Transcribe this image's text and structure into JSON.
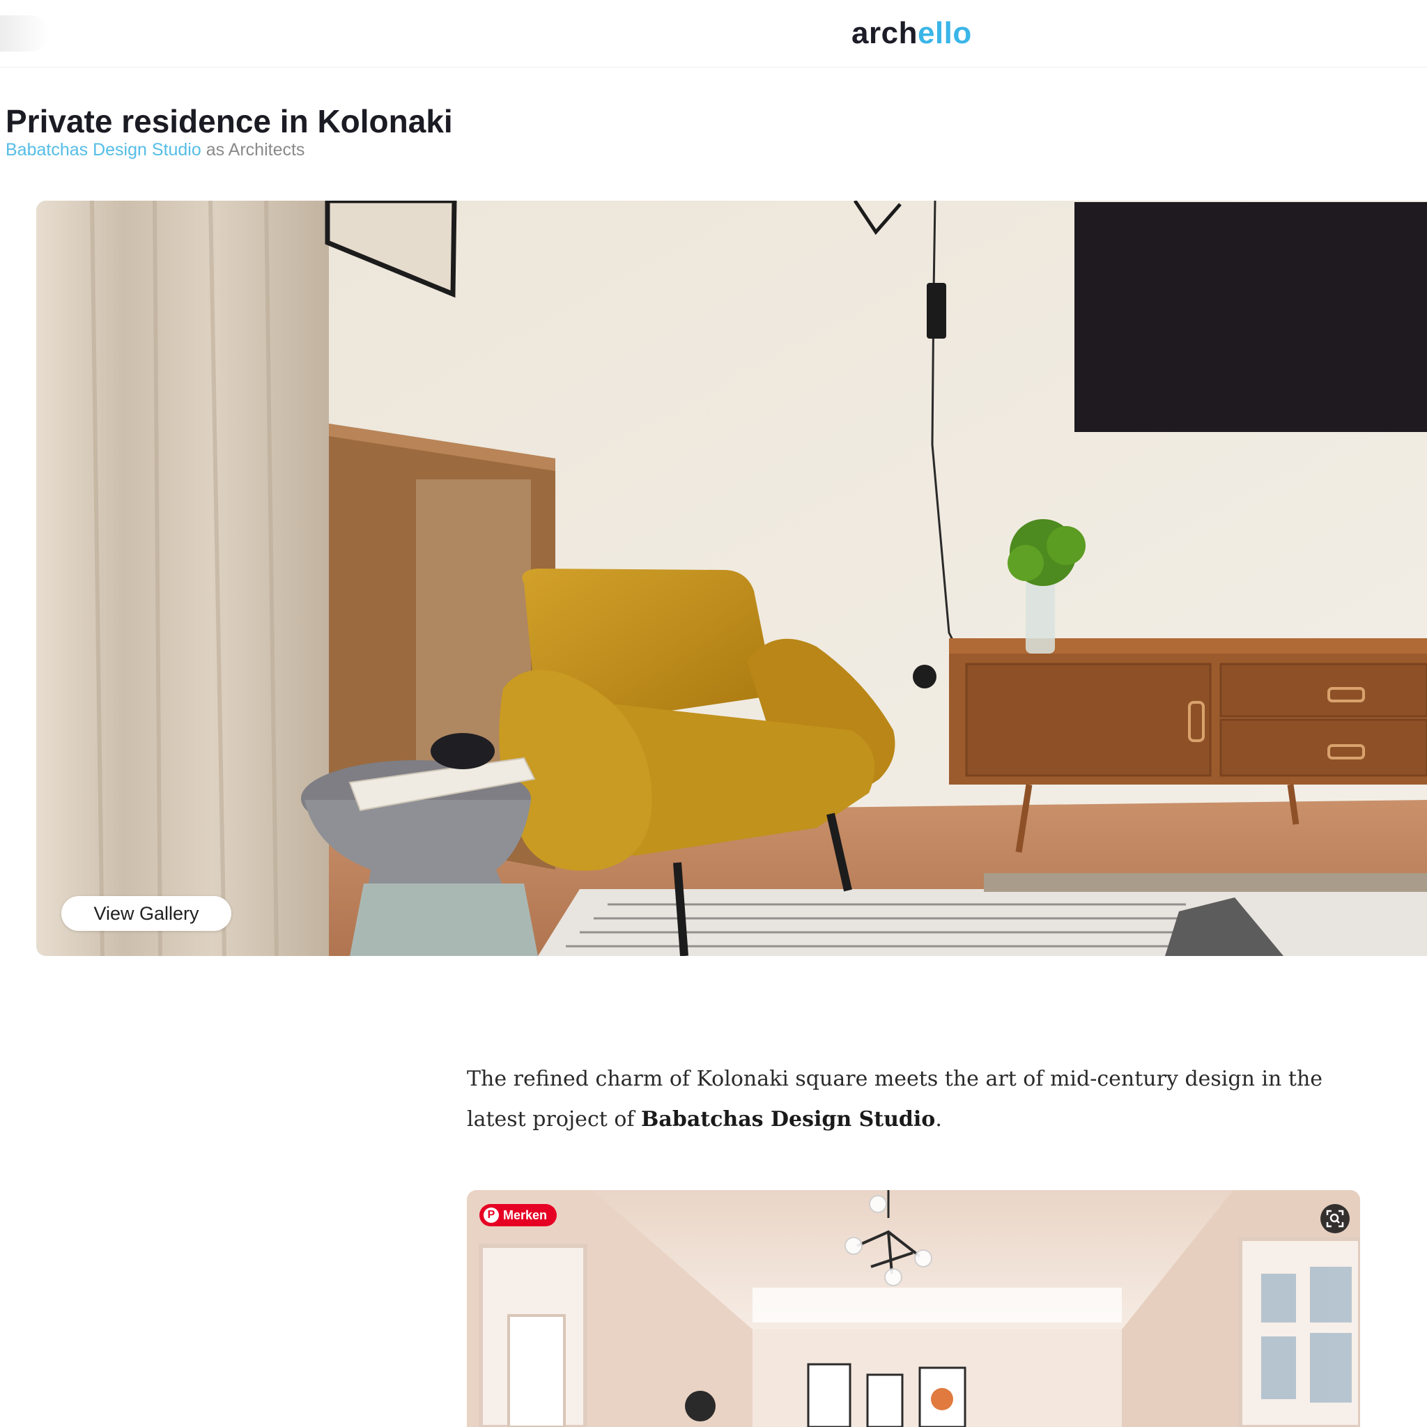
{
  "header": {
    "logo_part1": "arch",
    "logo_part2": "ello"
  },
  "project": {
    "title": "Private residence in Kolonaki",
    "studio": "Babatchas Design Studio",
    "role": " as Architects"
  },
  "hero": {
    "view_gallery_label": "View Gallery"
  },
  "intro": {
    "text_before": "The refined charm of Kolonaki square meets the art of mid-century design in the latest project of ",
    "studio_bold": "Babatchas Design Studio",
    "text_after": "."
  },
  "second_photo": {
    "pin_label": "Merken",
    "pin_icon": "pinterest-icon",
    "lens_icon": "visual-search-icon"
  },
  "colors": {
    "accent": "#3ab5e8",
    "pinterest": "#e60023"
  }
}
